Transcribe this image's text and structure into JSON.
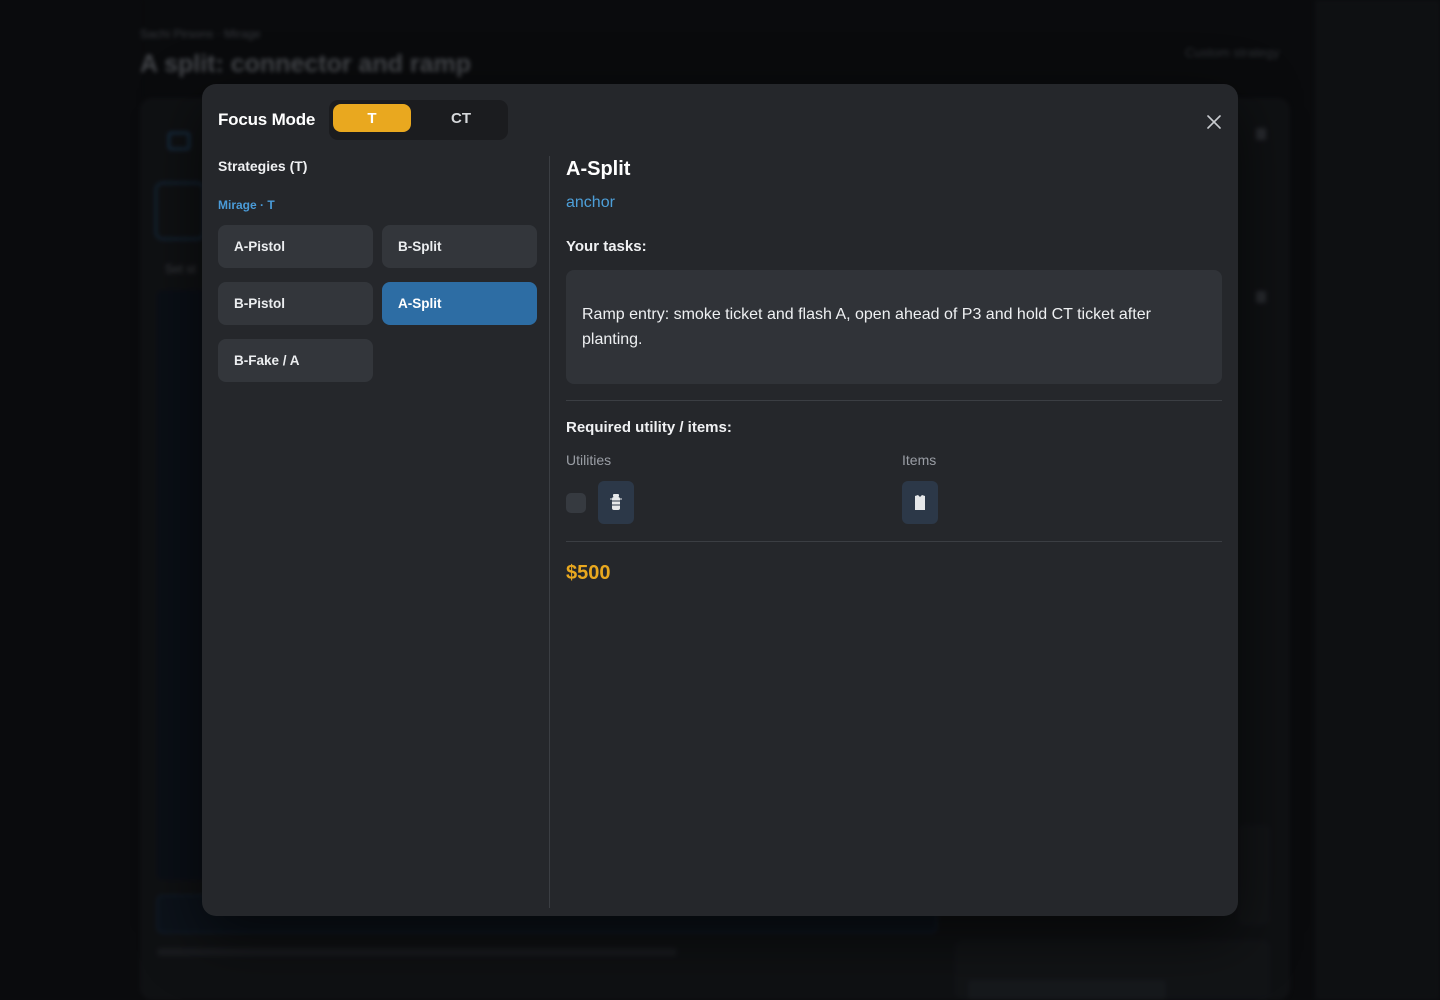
{
  "background": {
    "breadcrumb": "Sachi Pirsons · Mirage",
    "title": "A split: connector and ramp",
    "custom_label": "Custom strategy",
    "set_label": "Set st"
  },
  "modal": {
    "title": "Focus Mode",
    "side_toggle": {
      "options": [
        "T",
        "CT"
      ],
      "selected": "T"
    },
    "strategies_heading": "Strategies (T)",
    "map_label": "Mirage · T",
    "strategies": [
      {
        "label": "A-Pistol",
        "active": false
      },
      {
        "label": "B-Split",
        "active": false
      },
      {
        "label": "B-Pistol",
        "active": false
      },
      {
        "label": "A-Split",
        "active": true
      },
      {
        "label": "B-Fake / A",
        "active": false
      }
    ],
    "detail": {
      "title": "A-Split",
      "role": "anchor",
      "tasks_heading": "Your tasks:",
      "tasks_text": "Ramp entry: smoke ticket and flash A, open ahead of P3 and hold CT ticket after planting.",
      "utility_heading": "Required utility / items:",
      "utilities_label": "Utilities",
      "items_label": "Items",
      "utility_icons": [
        "flashbang-icon"
      ],
      "item_icons": [
        "armor-icon"
      ],
      "price": "$500"
    }
  },
  "colors": {
    "accent_t": "#e9a81f",
    "active_blue": "#2d6da4",
    "role_blue": "#4d9fd9",
    "modal_bg": "#25272b"
  }
}
